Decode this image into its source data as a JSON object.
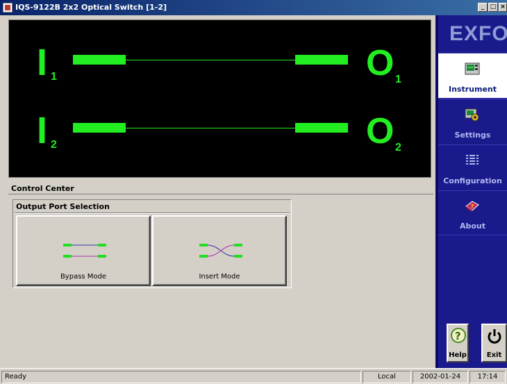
{
  "window": {
    "title": "IQS-9122B 2x2 Optical Switch [1-2]",
    "min_label": "_",
    "max_label": "□",
    "close_label": "×"
  },
  "display": {
    "inputs": [
      {
        "letter": "I",
        "sub": "1"
      },
      {
        "letter": "I",
        "sub": "2"
      }
    ],
    "outputs": [
      {
        "letter": "O",
        "sub": "1"
      },
      {
        "letter": "O",
        "sub": "2"
      }
    ],
    "color": "#22ee22"
  },
  "control_center": {
    "title": "Control Center",
    "group_title": "Output Port Selection",
    "bypass_label": "Bypass Mode",
    "insert_label": "Insert Mode"
  },
  "sidebar": {
    "logo": "EXFO",
    "items": [
      {
        "label": "Instrument",
        "icon": "instrument-icon",
        "active": true
      },
      {
        "label": "Settings",
        "icon": "settings-icon",
        "active": false
      },
      {
        "label": "Configuration",
        "icon": "configuration-icon",
        "active": false
      },
      {
        "label": "About",
        "icon": "about-icon",
        "active": false
      }
    ],
    "help_label": "Help",
    "exit_label": "Exit",
    "accent": "#1a1a8c"
  },
  "statusbar": {
    "status": "Ready",
    "mode": "Local",
    "date": "2002-01-24",
    "time": "17:14"
  }
}
